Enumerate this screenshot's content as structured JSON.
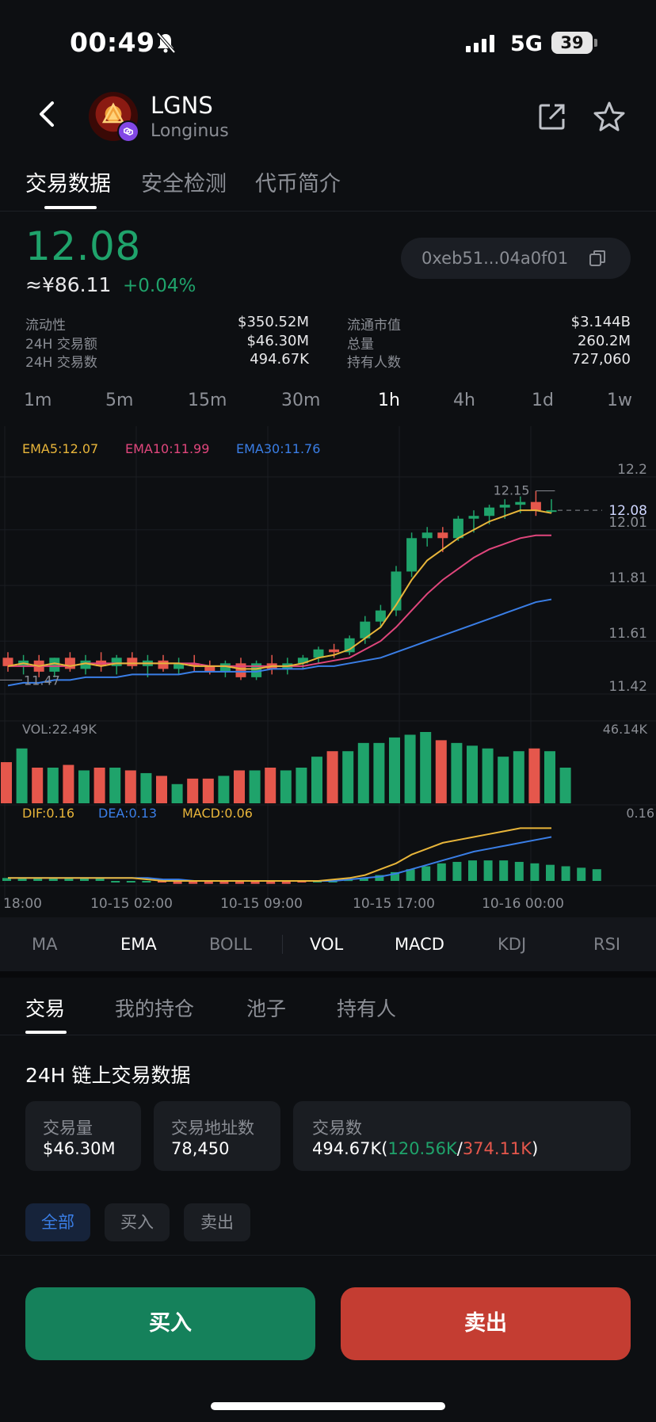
{
  "status_bar": {
    "time": "00:49",
    "network": "5G",
    "battery": "39"
  },
  "header": {
    "symbol": "LGNS",
    "name": "Longinus"
  },
  "tabs": [
    "交易数据",
    "安全检测",
    "代币简介"
  ],
  "price": {
    "value": "12.08",
    "cny": "≈¥86.11",
    "change": "+0.04%"
  },
  "contract_address": "0xeb51...04a0f01",
  "stats_left": [
    {
      "label": "流动性",
      "value": "$350.52M"
    },
    {
      "label": "24H 交易额",
      "value": "$46.30M"
    },
    {
      "label": "24H 交易数",
      "value": "494.67K"
    }
  ],
  "stats_right": [
    {
      "label": "流通市值",
      "value": "$3.144B"
    },
    {
      "label": "总量",
      "value": "260.2M"
    },
    {
      "label": "持有人数",
      "value": "727,060"
    }
  ],
  "timeframes": [
    "1m",
    "5m",
    "15m",
    "30m",
    "1h",
    "4h",
    "1d",
    "1w"
  ],
  "active_timeframe": "1h",
  "colors": {
    "up": "#1fa36b",
    "down": "#e5574c",
    "ema5": "#e8b53a",
    "ema10": "#e0467c",
    "ema30": "#3a7ee6",
    "accent": "#3a7ee6"
  },
  "chart_data": {
    "type": "candlestick",
    "legend": {
      "ema5": "EMA5:12.07",
      "ema10": "EMA10:11.99",
      "ema30": "EMA30:11.76"
    },
    "y_ticks": [
      "12.2",
      "12.01",
      "11.81",
      "11.61",
      "11.42"
    ],
    "y_range": [
      11.38,
      12.24
    ],
    "last_price_label": "12.08",
    "high_label": "12.15",
    "low_label": "11.47",
    "x_labels": [
      "18:00",
      "10-15 02:00",
      "10-15 09:00",
      "10-15 17:00",
      "10-16 00:00"
    ],
    "ohlc": [
      [
        11.55,
        11.57,
        11.5,
        11.52
      ],
      [
        11.52,
        11.56,
        11.49,
        11.54
      ],
      [
        11.54,
        11.56,
        11.48,
        11.5
      ],
      [
        11.5,
        11.55,
        11.48,
        11.55
      ],
      [
        11.55,
        11.57,
        11.5,
        11.51
      ],
      [
        11.51,
        11.56,
        11.49,
        11.54
      ],
      [
        11.54,
        11.57,
        11.5,
        11.52
      ],
      [
        11.52,
        11.56,
        11.49,
        11.55
      ],
      [
        11.55,
        11.57,
        11.51,
        11.52
      ],
      [
        11.52,
        11.56,
        11.48,
        11.54
      ],
      [
        11.54,
        11.56,
        11.5,
        11.51
      ],
      [
        11.51,
        11.55,
        11.49,
        11.53
      ],
      [
        11.53,
        11.56,
        11.5,
        11.52
      ],
      [
        11.52,
        11.54,
        11.49,
        11.5
      ],
      [
        11.5,
        11.54,
        11.48,
        11.53
      ],
      [
        11.53,
        11.55,
        11.47,
        11.48
      ],
      [
        11.48,
        11.54,
        11.47,
        11.53
      ],
      [
        11.53,
        11.56,
        11.49,
        11.51
      ],
      [
        11.51,
        11.55,
        11.49,
        11.53
      ],
      [
        11.53,
        11.56,
        11.51,
        11.55
      ],
      [
        11.55,
        11.59,
        11.53,
        11.58
      ],
      [
        11.58,
        11.6,
        11.55,
        11.57
      ],
      [
        11.57,
        11.63,
        11.56,
        11.62
      ],
      [
        11.62,
        11.7,
        11.6,
        11.68
      ],
      [
        11.68,
        11.74,
        11.66,
        11.72
      ],
      [
        11.72,
        11.88,
        11.7,
        11.86
      ],
      [
        11.86,
        12.0,
        11.84,
        11.98
      ],
      [
        11.98,
        12.02,
        11.95,
        12.0
      ],
      [
        12.0,
        12.02,
        11.93,
        11.98
      ],
      [
        11.98,
        12.06,
        11.97,
        12.05
      ],
      [
        12.05,
        12.08,
        12.0,
        12.06
      ],
      [
        12.06,
        12.1,
        12.03,
        12.09
      ],
      [
        12.09,
        12.12,
        12.05,
        12.1
      ],
      [
        12.1,
        12.13,
        12.07,
        12.11
      ],
      [
        12.11,
        12.15,
        12.06,
        12.08
      ],
      [
        12.08,
        12.12,
        12.07,
        12.08
      ]
    ],
    "ema5": [
      11.52,
      11.53,
      11.52,
      11.53,
      11.52,
      11.53,
      11.52,
      11.53,
      11.53,
      11.53,
      11.53,
      11.53,
      11.52,
      11.52,
      11.52,
      11.51,
      11.51,
      11.52,
      11.52,
      11.53,
      11.55,
      11.56,
      11.58,
      11.62,
      11.66,
      11.74,
      11.83,
      11.9,
      11.94,
      11.98,
      12.01,
      12.04,
      12.06,
      12.08,
      12.08,
      12.07
    ],
    "ema10": [
      11.52,
      11.52,
      11.52,
      11.52,
      11.52,
      11.53,
      11.53,
      11.53,
      11.53,
      11.53,
      11.53,
      11.53,
      11.53,
      11.52,
      11.52,
      11.52,
      11.52,
      11.52,
      11.52,
      11.52,
      11.53,
      11.54,
      11.55,
      11.58,
      11.61,
      11.66,
      11.72,
      11.78,
      11.83,
      11.87,
      11.91,
      11.94,
      11.96,
      11.98,
      11.99,
      11.99
    ],
    "ema30": [
      11.45,
      11.46,
      11.46,
      11.47,
      11.47,
      11.48,
      11.48,
      11.48,
      11.49,
      11.49,
      11.49,
      11.49,
      11.5,
      11.5,
      11.5,
      11.5,
      11.5,
      11.51,
      11.51,
      11.51,
      11.52,
      11.52,
      11.53,
      11.54,
      11.55,
      11.57,
      11.59,
      11.61,
      11.63,
      11.65,
      11.67,
      11.69,
      11.71,
      11.73,
      11.75,
      11.76
    ],
    "volume": {
      "label": "VOL:22.49K",
      "max_label": "46.14K",
      "values": [
        30,
        40,
        26,
        26,
        28,
        24,
        26,
        26,
        24,
        22,
        20,
        14,
        18,
        18,
        20,
        24,
        24,
        26,
        24,
        26,
        34,
        38,
        38,
        44,
        44,
        48,
        50,
        52,
        46,
        44,
        42,
        40,
        34,
        38,
        40,
        38,
        26
      ]
    },
    "macd": {
      "dif_label": "DIF:0.16",
      "dea_label": "DEA:0.13",
      "macd_label": "MACD:0.06",
      "axis_label": "0.16",
      "hist": [
        0.01,
        0.01,
        0.01,
        0.01,
        0.01,
        0.01,
        0.01,
        0.0,
        0.0,
        0.0,
        -0.005,
        -0.01,
        -0.01,
        -0.01,
        -0.01,
        -0.01,
        -0.01,
        -0.01,
        -0.01,
        -0.005,
        0.0,
        0.0,
        0.005,
        0.01,
        0.02,
        0.03,
        0.04,
        0.05,
        0.06,
        0.065,
        0.07,
        0.07,
        0.07,
        0.065,
        0.06,
        0.055,
        0.05,
        0.045,
        0.04
      ],
      "dif": [
        0.01,
        0.01,
        0.01,
        0.01,
        0.01,
        0.01,
        0.01,
        0.01,
        0.01,
        0.005,
        0.0,
        0.0,
        0.0,
        0.0,
        0.0,
        0.0,
        0.0,
        0.0,
        0.0,
        0.0,
        0.0,
        0.005,
        0.01,
        0.02,
        0.04,
        0.06,
        0.09,
        0.11,
        0.13,
        0.14,
        0.15,
        0.16,
        0.17,
        0.18,
        0.18,
        0.18
      ],
      "dea": [
        0.01,
        0.01,
        0.01,
        0.01,
        0.01,
        0.01,
        0.01,
        0.01,
        0.01,
        0.01,
        0.005,
        0.005,
        0.0,
        0.0,
        0.0,
        0.0,
        0.0,
        0.0,
        0.0,
        0.0,
        0.0,
        0.0,
        0.005,
        0.01,
        0.015,
        0.025,
        0.04,
        0.055,
        0.07,
        0.085,
        0.1,
        0.11,
        0.12,
        0.13,
        0.14,
        0.15
      ]
    }
  },
  "indicators": [
    "MA",
    "EMA",
    "BOLL",
    "VOL",
    "MACD",
    "KDJ",
    "RSI"
  ],
  "bottom_tabs": [
    "交易",
    "我的持仓",
    "池子",
    "持有人"
  ],
  "section_title": "24H 链上交易数据",
  "cards": {
    "volume": {
      "label": "交易量",
      "value": "$46.30M"
    },
    "addresses": {
      "label": "交易地址数",
      "value": "78,450"
    },
    "txns": {
      "label": "交易数",
      "value": "494.67K",
      "paren_open": "(",
      "buys": "120.56K",
      "slash": "/",
      "sells": "374.11K",
      "paren_close": ")"
    }
  },
  "filters": [
    "全部",
    "买入",
    "卖出"
  ],
  "actions": {
    "buy": "买入",
    "sell": "卖出"
  }
}
